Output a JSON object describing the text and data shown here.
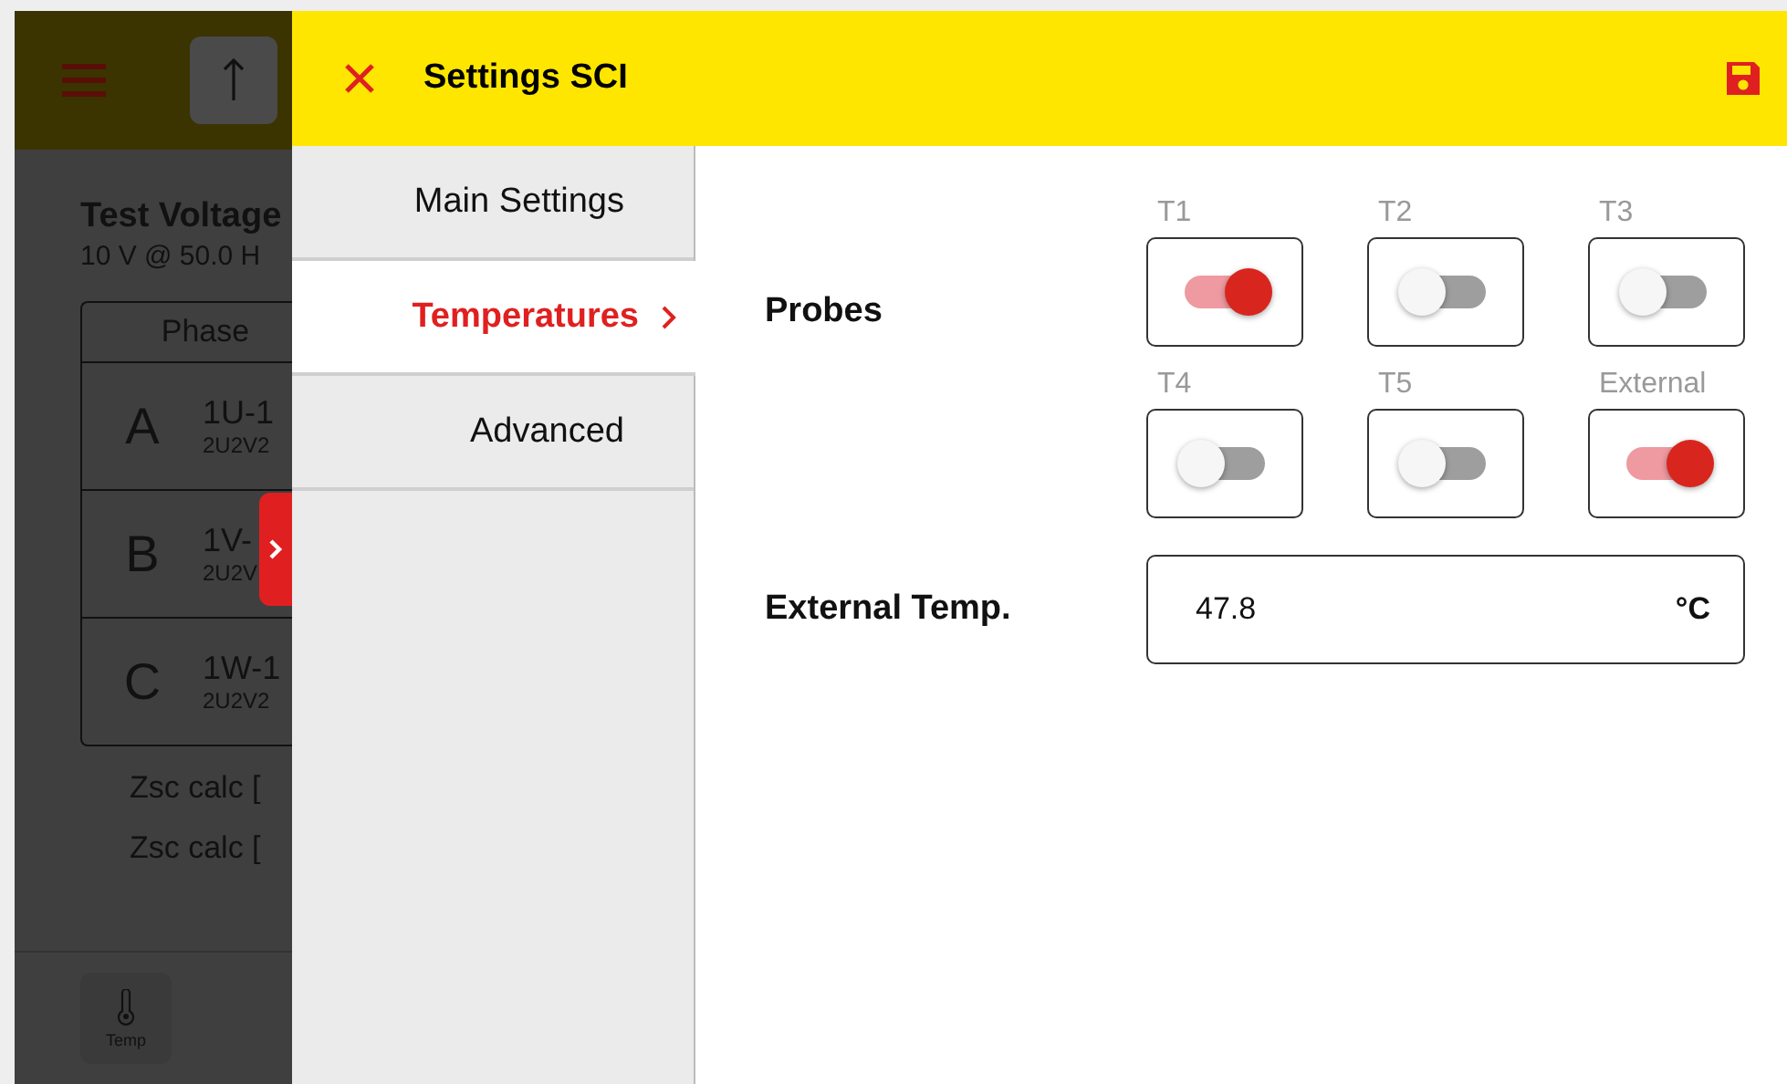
{
  "background_app": {
    "heading": "Test Voltage",
    "subheading": "10 V @ 50.0 H",
    "table": {
      "header": "Phase",
      "rows": [
        {
          "phase": "A",
          "line1": "1U-1",
          "line2": "2U2V2"
        },
        {
          "phase": "B",
          "line1": "1V-",
          "line2": "2U2V"
        },
        {
          "phase": "C",
          "line1": "1W-1",
          "line2": "2U2V2"
        }
      ]
    },
    "readings": [
      "Zsc calc [",
      "Zsc calc ["
    ],
    "bottom_button": {
      "label": "Temp"
    }
  },
  "settings": {
    "title": "Settings SCI",
    "nav": [
      {
        "label": "Main Settings",
        "selected": false
      },
      {
        "label": "Temperatures",
        "selected": true
      },
      {
        "label": "Advanced",
        "selected": false
      }
    ],
    "probes_label": "Probes",
    "probes": [
      {
        "label": "T1",
        "on": true
      },
      {
        "label": "T2",
        "on": false
      },
      {
        "label": "T3",
        "on": false
      },
      {
        "label": "T4",
        "on": false
      },
      {
        "label": "T5",
        "on": false
      },
      {
        "label": "External",
        "on": true
      }
    ],
    "external_temp": {
      "label": "External Temp.",
      "value": "47.8",
      "unit": "°C"
    }
  }
}
